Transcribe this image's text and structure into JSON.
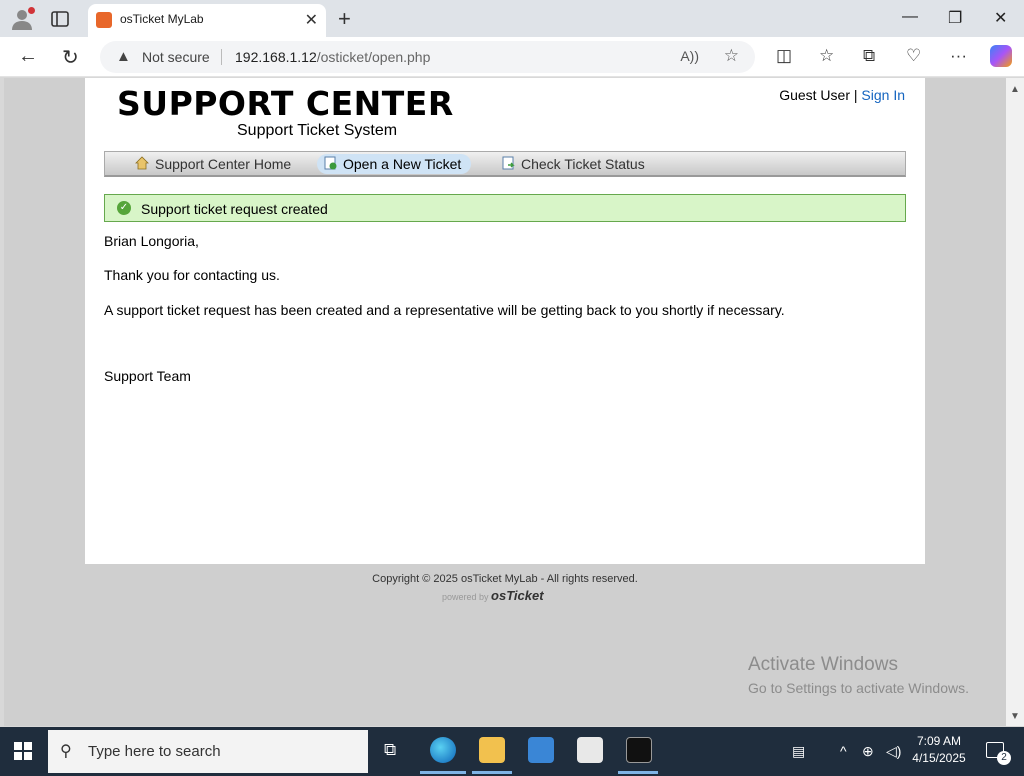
{
  "browser": {
    "tab_title": "osTicket MyLab",
    "security_label": "Not secure",
    "url_host": "192.168.1.12",
    "url_path": "/osticket/open.php"
  },
  "header": {
    "logo_main": "SUPPORT CENTER",
    "logo_sub": "Support Ticket System",
    "guest_label": "Guest User |",
    "sign_in": "Sign In"
  },
  "nav": {
    "items": [
      {
        "label": "Support Center Home"
      },
      {
        "label": "Open a New Ticket"
      },
      {
        "label": "Check Ticket Status"
      }
    ]
  },
  "notice": {
    "text": "Support ticket request created"
  },
  "content": {
    "greeting": "Brian Longoria,",
    "thanks": "Thank you for contacting us.",
    "message": "A support ticket request has been created and a representative will be getting back to you shortly if necessary.",
    "signature": "Support Team"
  },
  "footer": {
    "copyright": "Copyright © 2025 osTicket MyLab - All rights reserved.",
    "powered_by": "powered by",
    "brand": "osTicket"
  },
  "watermark": {
    "title": "Activate Windows",
    "subtitle": "Go to Settings to activate Windows."
  },
  "taskbar": {
    "search_placeholder": "Type here to search",
    "time": "7:09 AM",
    "date": "4/15/2025",
    "notification_count": "2"
  },
  "colors": {
    "notice_bg": "#d8f5c8",
    "link": "#1565c0",
    "taskbar": "#1f2d3d"
  }
}
